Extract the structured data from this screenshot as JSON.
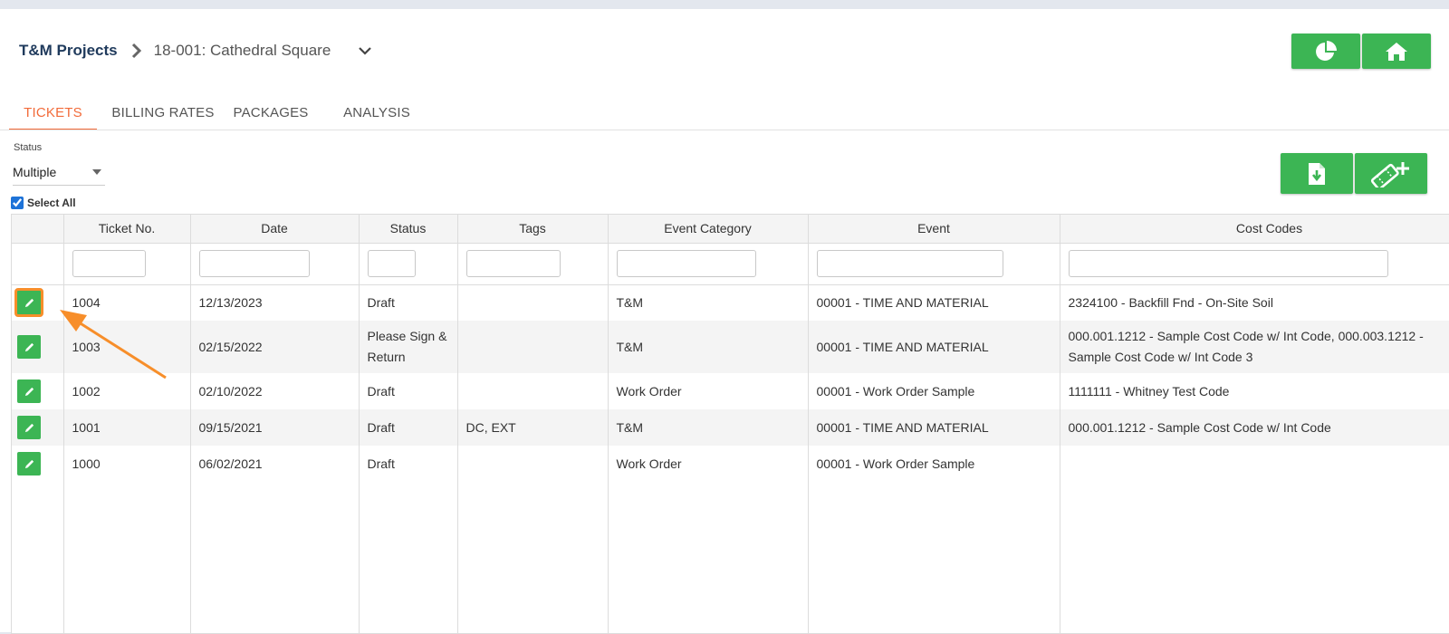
{
  "breadcrumb": {
    "root": "T&M Projects",
    "project": "18-001: Cathedral Square"
  },
  "top_actions": {
    "icons": [
      "pie-chart-icon",
      "home-icon"
    ]
  },
  "tabs": [
    {
      "label": "TICKETS",
      "active": true
    },
    {
      "label": "BILLING RATES",
      "active": false
    },
    {
      "label": "PACKAGES",
      "active": false
    },
    {
      "label": "ANALYSIS",
      "active": false
    }
  ],
  "filters": {
    "status_label": "Status",
    "status_value": "Multiple",
    "select_all_label": "Select All",
    "select_all_checked": true
  },
  "grid_actions": {
    "icons": [
      "download-file-icon",
      "add-ticket-icon"
    ]
  },
  "table": {
    "columns": [
      "",
      "Ticket No.",
      "Date",
      "Status",
      "Tags",
      "Event Category",
      "Event",
      "Cost Codes"
    ],
    "rows": [
      {
        "ticket_no": "1004",
        "date": "12/13/2023",
        "status": "Draft",
        "tags": "",
        "event_category": "T&M",
        "event": "00001 - TIME AND MATERIAL",
        "cost_codes": "2324100 - Backfill Fnd - On-Site Soil"
      },
      {
        "ticket_no": "1003",
        "date": "02/15/2022",
        "status": "Please Sign & Return",
        "tags": "",
        "event_category": "T&M",
        "event": "00001 - TIME AND MATERIAL",
        "cost_codes": "000.001.1212 - Sample Cost Code w/ Int Code, 000.003.1212 - Sample Cost Code w/ Int Code 3"
      },
      {
        "ticket_no": "1002",
        "date": "02/10/2022",
        "status": "Draft",
        "tags": "",
        "event_category": "Work Order",
        "event": "00001 - Work Order Sample",
        "cost_codes": "1111111 - Whitney Test Code"
      },
      {
        "ticket_no": "1001",
        "date": "09/15/2021",
        "status": "Draft",
        "tags": "DC, EXT",
        "event_category": "T&M",
        "event": "00001 - TIME AND MATERIAL",
        "cost_codes": "000.001.1212 - Sample Cost Code w/ Int Code"
      },
      {
        "ticket_no": "1000",
        "date": "06/02/2021",
        "status": "Draft",
        "tags": "",
        "event_category": "Work Order",
        "event": "00001 - Work Order Sample",
        "cost_codes": ""
      }
    ]
  },
  "colors": {
    "accent_green": "#3cb554",
    "active_tab": "#f26b3a",
    "annotation_orange": "#f78e2a",
    "title_navy": "#1f3a5c"
  }
}
